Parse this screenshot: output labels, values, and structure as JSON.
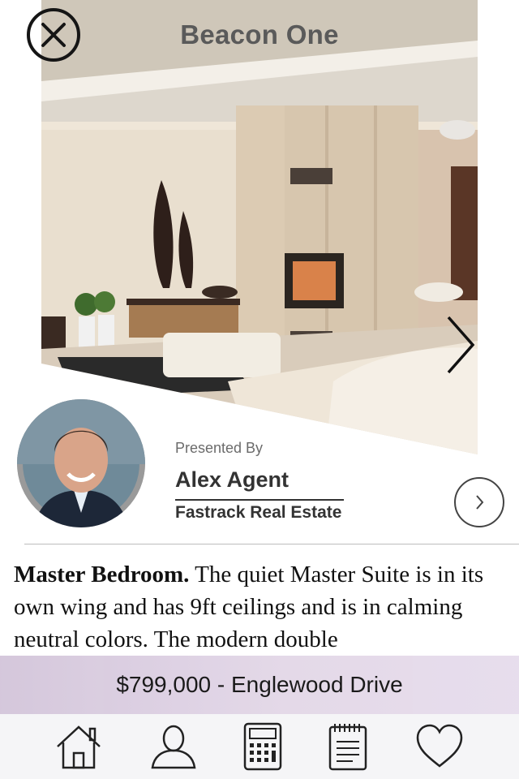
{
  "header": {
    "title": "Beacon One"
  },
  "agent": {
    "presented_label": "Presented By",
    "name": "Alex Agent",
    "agency": "Fastrack Real Estate"
  },
  "description": {
    "heading": "Master Bedroom.",
    "body": " The quiet Master Suite is in its own wing and has 9ft ceilings and is in calming neutral colors. The modern double"
  },
  "listing": {
    "price_address": "$799,000 - Englewood Drive"
  },
  "tabs": [
    {
      "icon": "home-icon"
    },
    {
      "icon": "user-icon"
    },
    {
      "icon": "calculator-icon"
    },
    {
      "icon": "calendar-icon"
    },
    {
      "icon": "heart-icon"
    }
  ]
}
